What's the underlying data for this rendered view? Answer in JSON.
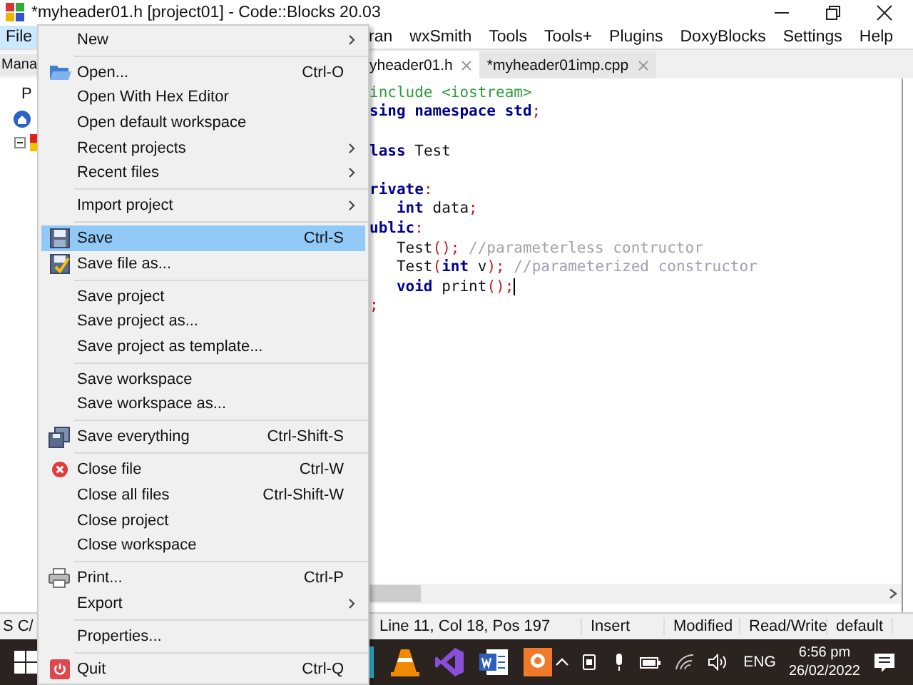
{
  "window": {
    "title": "*myheader01.h [project01] - Code::Blocks 20.03"
  },
  "menu_bar": [
    {
      "label": "File",
      "selected": true
    },
    {
      "label": "ran",
      "selected": false
    },
    {
      "label": "wxSmith",
      "selected": false
    },
    {
      "label": "Tools",
      "selected": false
    },
    {
      "label": "Tools+",
      "selected": false
    },
    {
      "label": "Plugins",
      "selected": false
    },
    {
      "label": "DoxyBlocks",
      "selected": false
    },
    {
      "label": "Settings",
      "selected": false
    },
    {
      "label": "Help",
      "selected": false
    }
  ],
  "file_menu": [
    {
      "kind": "item",
      "label": "New",
      "submenu": true,
      "selected": false
    },
    {
      "kind": "separator"
    },
    {
      "kind": "item",
      "label": "Open...",
      "shortcut": "Ctrl-O",
      "submenu": false,
      "selected": false
    },
    {
      "kind": "item",
      "label": "Open With Hex Editor",
      "submenu": false,
      "selected": false
    },
    {
      "kind": "item",
      "label": "Open default workspace",
      "submenu": false,
      "selected": false
    },
    {
      "kind": "item",
      "label": "Recent projects",
      "submenu": true,
      "selected": false
    },
    {
      "kind": "item",
      "label": "Recent files",
      "submenu": true,
      "selected": false
    },
    {
      "kind": "separator"
    },
    {
      "kind": "item",
      "label": "Import project",
      "submenu": true,
      "selected": false
    },
    {
      "kind": "separator"
    },
    {
      "kind": "item",
      "label": "Save",
      "shortcut": "Ctrl-S",
      "submenu": false,
      "selected": true
    },
    {
      "kind": "item",
      "label": "Save file as...",
      "submenu": false,
      "selected": false
    },
    {
      "kind": "separator"
    },
    {
      "kind": "item",
      "label": "Save project",
      "submenu": false,
      "selected": false
    },
    {
      "kind": "item",
      "label": "Save project as...",
      "submenu": false,
      "selected": false
    },
    {
      "kind": "item",
      "label": "Save project as template...",
      "submenu": false,
      "selected": false
    },
    {
      "kind": "separator"
    },
    {
      "kind": "item",
      "label": "Save workspace",
      "submenu": false,
      "selected": false
    },
    {
      "kind": "item",
      "label": "Save workspace as...",
      "submenu": false,
      "selected": false
    },
    {
      "kind": "separator"
    },
    {
      "kind": "item",
      "label": "Save everything",
      "shortcut": "Ctrl-Shift-S",
      "submenu": false,
      "selected": false
    },
    {
      "kind": "separator"
    },
    {
      "kind": "item",
      "label": "Close file",
      "shortcut": "Ctrl-W",
      "submenu": false,
      "selected": false
    },
    {
      "kind": "item",
      "label": "Close all files",
      "shortcut": "Ctrl-Shift-W",
      "submenu": false,
      "selected": false
    },
    {
      "kind": "item",
      "label": "Close project",
      "submenu": false,
      "selected": false
    },
    {
      "kind": "item",
      "label": "Close workspace",
      "submenu": false,
      "selected": false
    },
    {
      "kind": "separator"
    },
    {
      "kind": "item",
      "label": "Print...",
      "shortcut": "Ctrl-P",
      "submenu": false,
      "selected": false
    },
    {
      "kind": "item",
      "label": "Export",
      "submenu": true,
      "selected": false
    },
    {
      "kind": "separator"
    },
    {
      "kind": "item",
      "label": "Properties...",
      "submenu": false,
      "selected": false
    },
    {
      "kind": "separator"
    },
    {
      "kind": "item",
      "label": "Quit",
      "shortcut": "Ctrl-Q",
      "submenu": false,
      "selected": false
    }
  ],
  "management_panel": {
    "tab": "Mana",
    "line": "P"
  },
  "editor_tabs": [
    {
      "label": "yheader01.h",
      "selected": true
    },
    {
      "label": "*myheader01imp.cpp",
      "selected": false
    }
  ],
  "code_lines": [
    {
      "kind": "code",
      "indent": false,
      "segments": [
        {
          "kind": "preproc",
          "text": "include <iostream>"
        }
      ]
    },
    {
      "kind": "code",
      "indent": false,
      "segments": [
        {
          "kind": "keyword",
          "text": "sing namespace std"
        },
        {
          "kind": "punct",
          "text": ";"
        }
      ]
    },
    {
      "kind": "blank"
    },
    {
      "kind": "code",
      "indent": false,
      "segments": [
        {
          "kind": "keyword",
          "text": "lass"
        },
        {
          "kind": "plain",
          "text": " Test"
        }
      ]
    },
    {
      "kind": "blank"
    },
    {
      "kind": "code",
      "indent": false,
      "segments": [
        {
          "kind": "keyword",
          "text": "rivate"
        },
        {
          "kind": "punct",
          "text": ":"
        }
      ]
    },
    {
      "kind": "code",
      "indent": true,
      "segments": [
        {
          "kind": "keyword",
          "text": "int"
        },
        {
          "kind": "plain",
          "text": " data"
        },
        {
          "kind": "punct",
          "text": ";"
        }
      ]
    },
    {
      "kind": "code",
      "indent": false,
      "segments": [
        {
          "kind": "keyword",
          "text": "ublic"
        },
        {
          "kind": "punct",
          "text": ":"
        }
      ]
    },
    {
      "kind": "code",
      "indent": true,
      "segments": [
        {
          "kind": "plain",
          "text": "Test"
        },
        {
          "kind": "punct",
          "text": "();"
        },
        {
          "kind": "comment",
          "text": " //parameterless contructor"
        }
      ]
    },
    {
      "kind": "code",
      "indent": true,
      "segments": [
        {
          "kind": "plain",
          "text": "Test"
        },
        {
          "kind": "punct",
          "text": "("
        },
        {
          "kind": "keyword",
          "text": "int"
        },
        {
          "kind": "plain",
          "text": " v"
        },
        {
          "kind": "punct",
          "text": ");"
        },
        {
          "kind": "comment",
          "text": " //parameterized constructor"
        }
      ]
    },
    {
      "kind": "code",
      "indent": true,
      "segments": [
        {
          "kind": "keyword",
          "text": "void"
        },
        {
          "kind": "plain",
          "text": " print"
        },
        {
          "kind": "punct",
          "text": "();"
        }
      ],
      "cursor": true
    },
    {
      "kind": "code",
      "indent": false,
      "segments": [
        {
          "kind": "punct",
          "text": ";"
        }
      ]
    }
  ],
  "status_bar": {
    "left": [
      "S",
      "C/"
    ],
    "fields": [
      "Line 11, Col 18, Pos 197",
      "Insert",
      "Modified",
      "Read/Write",
      "default"
    ]
  },
  "taskbar": {
    "language": "ENG",
    "time": "6:56 pm",
    "date": "26/02/2022"
  }
}
